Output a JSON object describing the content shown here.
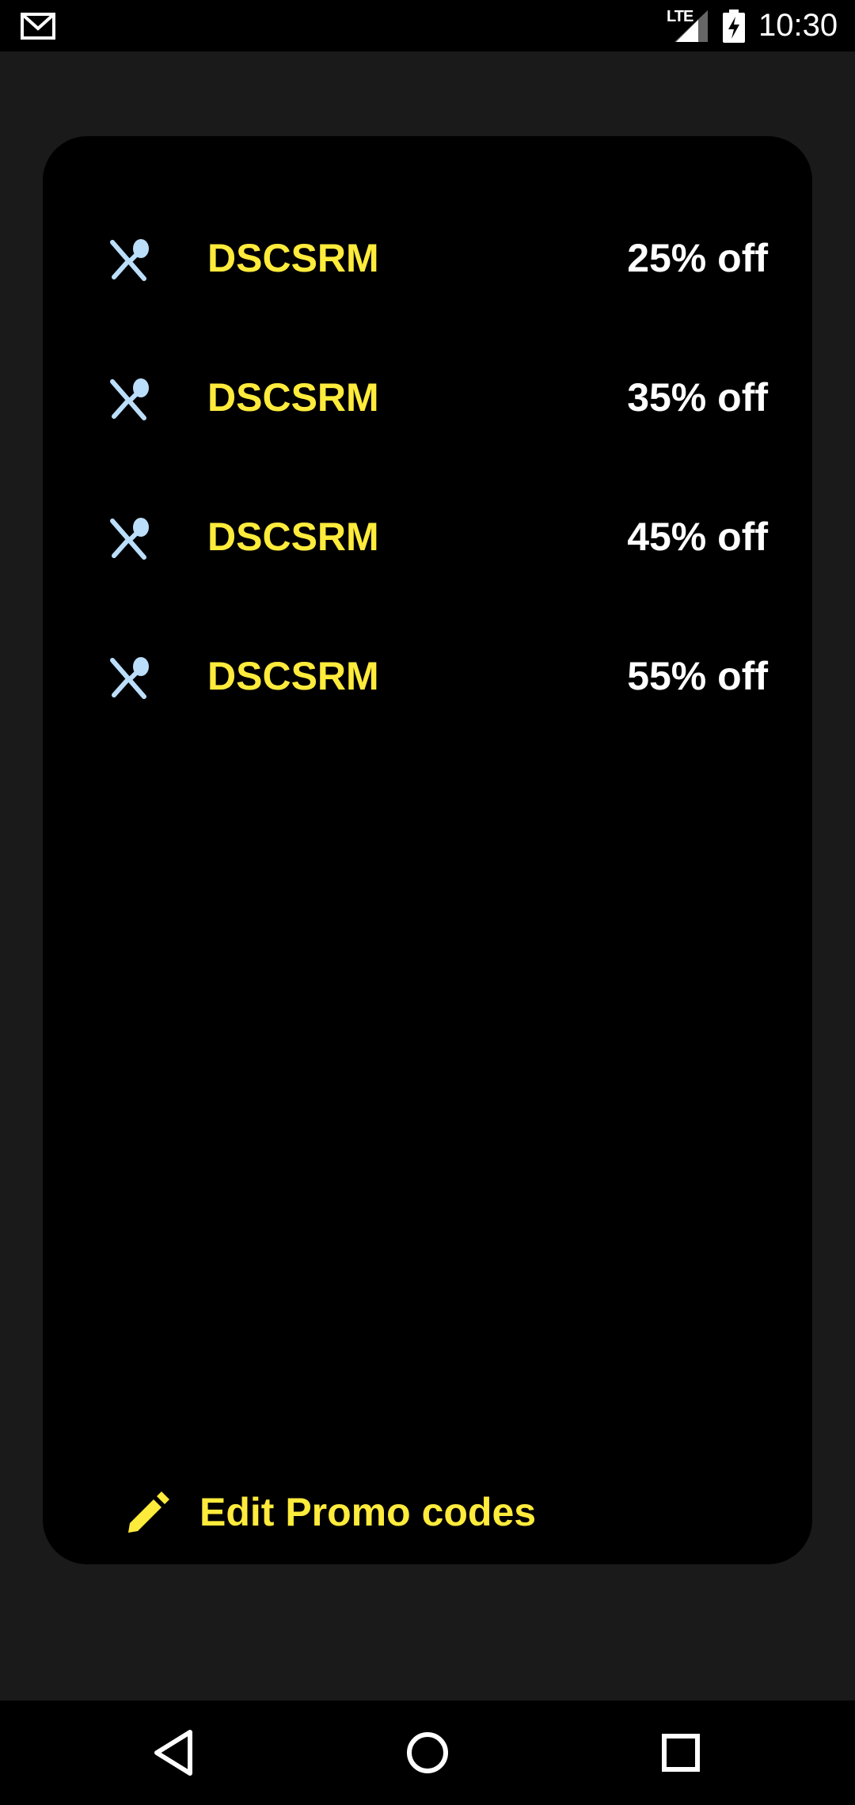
{
  "status_bar": {
    "network": "LTE",
    "time": "10:30",
    "icons": [
      "gmail-icon",
      "signal-icon",
      "battery-charging-icon"
    ]
  },
  "promos": [
    {
      "icon": "restaurant-icon",
      "code": "DSCSRM",
      "discount": "25% off"
    },
    {
      "icon": "restaurant-icon",
      "code": "DSCSRM",
      "discount": "35% off"
    },
    {
      "icon": "restaurant-icon",
      "code": "DSCSRM",
      "discount": "45% off"
    },
    {
      "icon": "restaurant-icon",
      "code": "DSCSRM",
      "discount": "55% off"
    }
  ],
  "edit": {
    "icon": "pencil-icon",
    "label": "Edit Promo codes"
  },
  "nav_bar": {
    "icons": [
      "back-icon",
      "home-icon",
      "recents-icon"
    ]
  },
  "colors": {
    "background": "#1a1a1a",
    "card": "#000000",
    "accent": "#ffeb3b",
    "icon": "#bbdefb",
    "text": "#ffffff"
  }
}
